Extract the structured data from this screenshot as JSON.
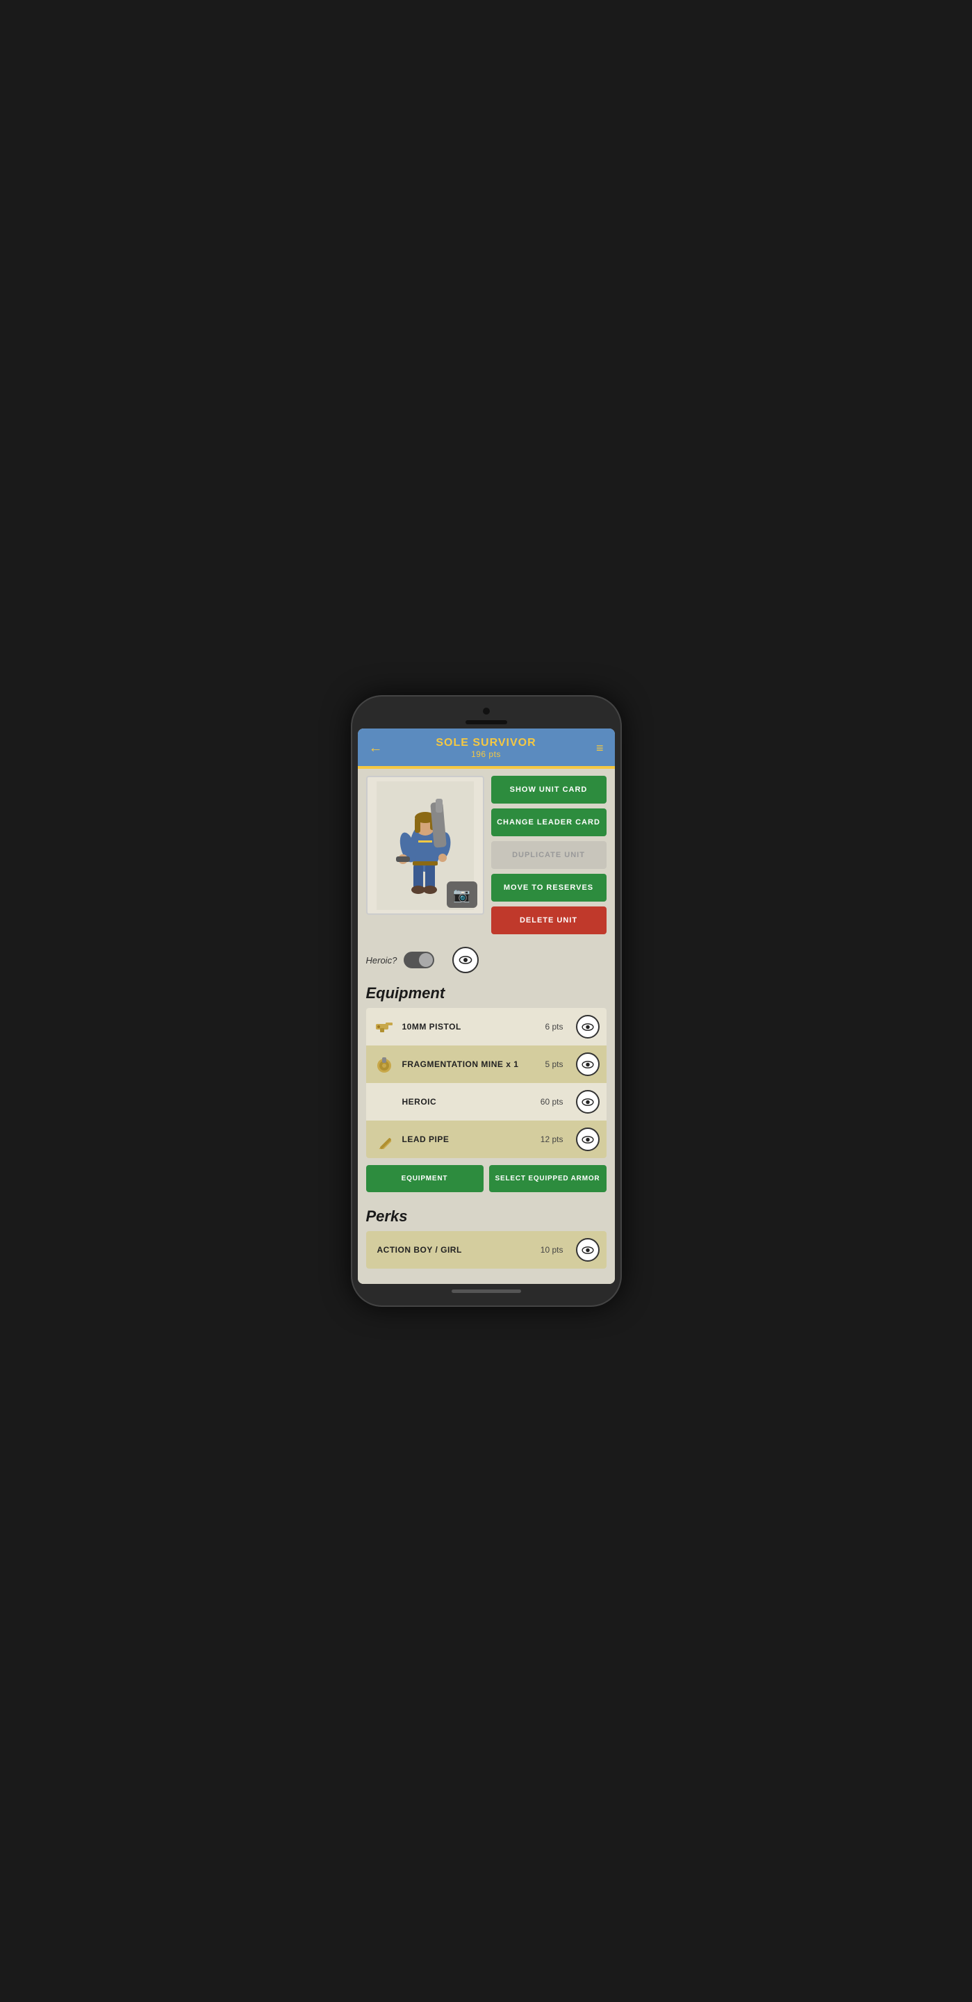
{
  "header": {
    "title": "SOLE SURVIVOR",
    "pts": "196 pts",
    "back_arrow": "←",
    "menu_icon": "≡"
  },
  "buttons": {
    "show_unit_card": "SHOW UNIT CARD",
    "change_leader_card": "CHANGE LEADER CARD",
    "duplicate_unit": "DUPLICATE UNIT",
    "move_to_reserves": "MOVE TO RESERVES",
    "delete_unit": "DELETE UNIT",
    "equipment": "EQUIPMENT",
    "select_equipped_armor": "SELECT EQUIPPED ARMOR"
  },
  "heroic_label": "Heroic?",
  "sections": {
    "equipment_title": "Equipment",
    "perks_title": "Perks"
  },
  "equipment": [
    {
      "name": "10MM PISTOL",
      "pts": "6 pts",
      "has_icon": true,
      "icon_type": "pistol",
      "row_style": "light"
    },
    {
      "name": "FRAGMENTATION MINE  x 1",
      "pts": "5 pts",
      "has_icon": true,
      "icon_type": "mine",
      "row_style": "dark"
    },
    {
      "name": "HEROIC",
      "pts": "60 pts",
      "has_icon": false,
      "icon_type": "",
      "row_style": "light"
    },
    {
      "name": "LEAD PIPE",
      "pts": "12 pts",
      "has_icon": true,
      "icon_type": "pipe",
      "row_style": "dark"
    }
  ],
  "perks": [
    {
      "name": "ACTION BOY / GIRL",
      "pts": "10 pts",
      "row_style": "dark"
    }
  ]
}
